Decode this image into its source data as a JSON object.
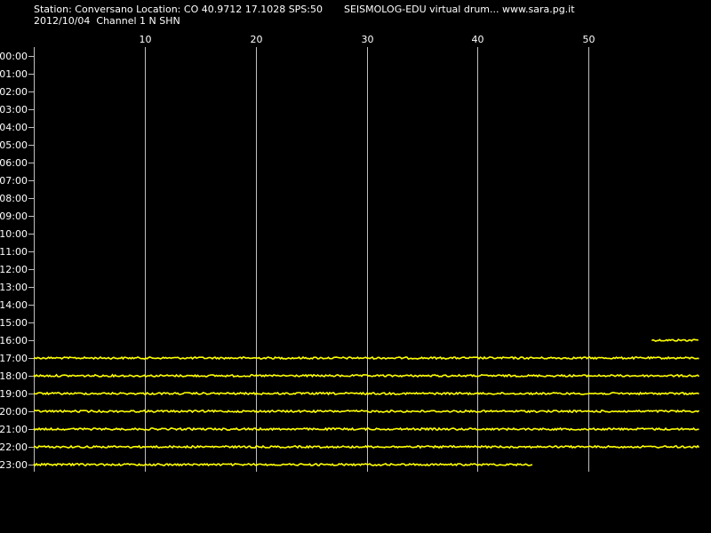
{
  "header": {
    "station_line": "Station: Conversano Location: CO 40.9712 17.1028 SPS:50",
    "app_line": "SEISMOLOG-EDU virtual drum... www.sara.pg.it",
    "date_line": "2012/10/04  Channel 1 N SHN"
  },
  "colors": {
    "background": "#000000",
    "trace": "#ffff00",
    "grid": "#c0c0c0",
    "text": "#ffffff"
  },
  "chart_data": {
    "type": "line",
    "x_ticks": [
      "10",
      "20",
      "30",
      "40",
      "50"
    ],
    "xlim": [
      0,
      60
    ],
    "y_ticks": [
      "00:00",
      "01:00",
      "02:00",
      "03:00",
      "04:00",
      "05:00",
      "06:00",
      "07:00",
      "08:00",
      "09:00",
      "10:00",
      "11:00",
      "12:00",
      "13:00",
      "14:00",
      "15:00",
      "16:00",
      "17:00",
      "18:00",
      "19:00",
      "20:00",
      "21:00",
      "22:00",
      "23:00"
    ],
    "grid": true,
    "traces": [
      {
        "hour": "16:00",
        "start_min": 55.7,
        "end_min": 60
      },
      {
        "hour": "17:00",
        "start_min": 0,
        "end_min": 60
      },
      {
        "hour": "18:00",
        "start_min": 0,
        "end_min": 60
      },
      {
        "hour": "19:00",
        "start_min": 0,
        "end_min": 60
      },
      {
        "hour": "20:00",
        "start_min": 0,
        "end_min": 60
      },
      {
        "hour": "21:00",
        "start_min": 0,
        "end_min": 60
      },
      {
        "hour": "22:00",
        "start_min": 0,
        "end_min": 60
      },
      {
        "hour": "23:00",
        "start_min": 0,
        "end_min": 45
      }
    ]
  }
}
